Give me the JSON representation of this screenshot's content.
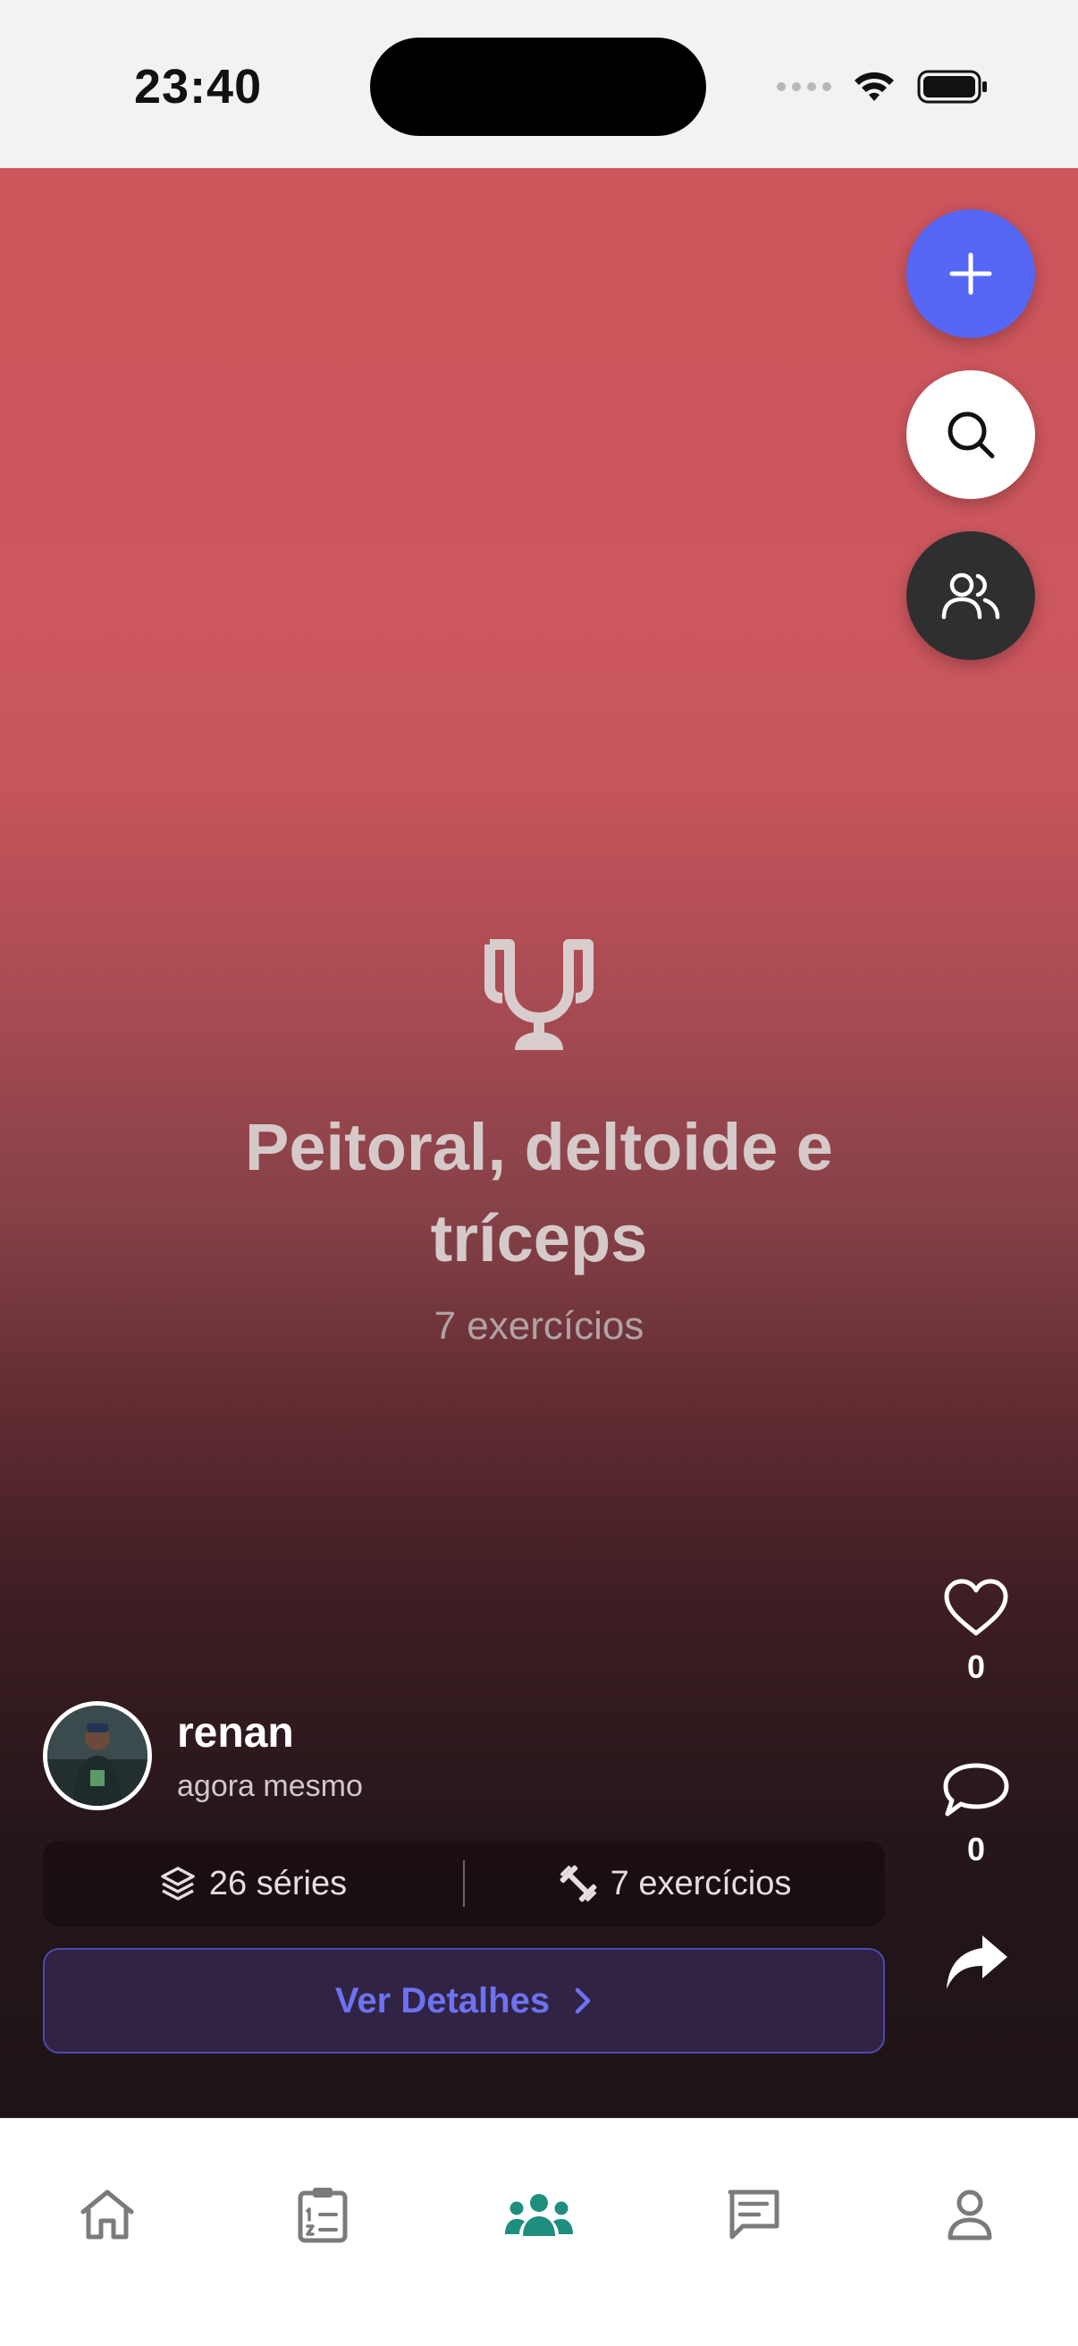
{
  "status_bar": {
    "time": "23:40"
  },
  "post": {
    "title": "Peitoral, deltoide e tríceps",
    "subtitle": "7 exercícios",
    "user": {
      "name": "renan",
      "time": "agora mesmo"
    },
    "stats": {
      "series": "26 séries",
      "exercises": "7 exercícios"
    },
    "details_button": "Ver Detalhes",
    "likes": "0",
    "comments": "0"
  },
  "tabs": [
    {
      "name": "home",
      "active": false
    },
    {
      "name": "workouts",
      "active": false
    },
    {
      "name": "community",
      "active": true
    },
    {
      "name": "messages",
      "active": false
    },
    {
      "name": "profile",
      "active": false
    }
  ],
  "colors": {
    "accent": "#5666f5",
    "active_tab": "#1f8e7e",
    "inactive_tab": "#7b7b7b",
    "details_text": "#6d72f2"
  }
}
